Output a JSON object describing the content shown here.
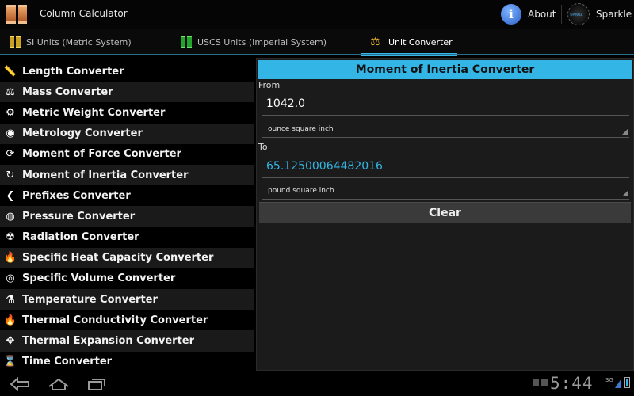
{
  "app": {
    "title": "Column Calculator",
    "about_label": "About",
    "sparkle_label": "Sparkle",
    "sparkle_logo_text": "SPARKLE"
  },
  "tabs": [
    {
      "label": "SI Units (Metric System)",
      "icon": "gold-columns-icon"
    },
    {
      "label": "USCS Units (Imperial System)",
      "icon": "green-columns-icon"
    },
    {
      "label": "Unit Converter",
      "icon": "scales-icon",
      "selected": true
    }
  ],
  "converters": [
    {
      "label": "Length Converter",
      "icon": "ruler-icon",
      "glyph": "📏"
    },
    {
      "label": "Mass Converter",
      "icon": "weight-icon",
      "glyph": "⚖"
    },
    {
      "label": "Metric Weight Converter",
      "icon": "weights-icon",
      "glyph": "⚙"
    },
    {
      "label": "Metrology Converter",
      "icon": "metrology-icon",
      "glyph": "◉"
    },
    {
      "label": "Moment of Force Converter",
      "icon": "rotation-arrows-icon",
      "glyph": "⟳"
    },
    {
      "label": "Moment of Inertia  Converter",
      "icon": "inertia-arrow-icon",
      "glyph": "↻"
    },
    {
      "label": "Prefixes Converter",
      "icon": "chevron-left-icon",
      "glyph": "❮"
    },
    {
      "label": "Pressure Converter",
      "icon": "gauge-icon",
      "glyph": "◍"
    },
    {
      "label": "Radiation Converter",
      "icon": "radiation-icon",
      "glyph": "☢"
    },
    {
      "label": "Specific Heat Capacity Converter",
      "icon": "flame-icon",
      "glyph": "🔥"
    },
    {
      "label": "Specific Volume Converter",
      "icon": "coil-icon",
      "glyph": "◎"
    },
    {
      "label": "Temperature Converter",
      "icon": "flask-icon",
      "glyph": "⚗"
    },
    {
      "label": "Thermal Conductivity Converter",
      "icon": "fire-icon",
      "glyph": "🔥"
    },
    {
      "label": "Thermal Expansion Converter",
      "icon": "expand-arrows-icon",
      "glyph": "✥"
    },
    {
      "label": "Time Converter",
      "icon": "hourglass-icon",
      "glyph": "⌛"
    }
  ],
  "panel": {
    "title": "Moment of Inertia Converter",
    "from_label": "From",
    "from_value": "1042.0",
    "from_unit": "ounce square inch",
    "to_label": "To",
    "to_value": "65.12500064482016",
    "to_unit": "pound square inch",
    "clear_label": "Clear"
  },
  "status": {
    "time": "5:44",
    "signal": "3G"
  },
  "colors": {
    "accent": "#33b5e5",
    "background": "#000000"
  }
}
